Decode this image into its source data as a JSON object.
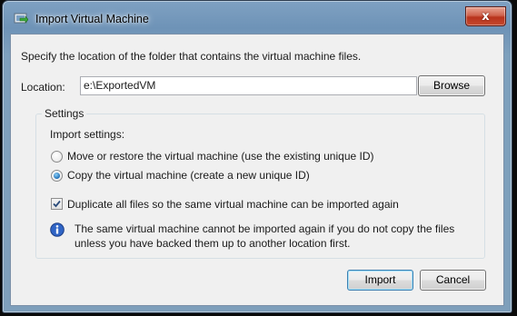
{
  "window": {
    "title": "Import Virtual Machine",
    "close_label": "x"
  },
  "dialog": {
    "instructions": "Specify the location of the folder that contains the virtual machine files.",
    "location_label": "Location:",
    "location_value": "e:\\ExportedVM",
    "browse_label": "Browse",
    "settings": {
      "legend": "Settings",
      "import_settings_label": "Import settings:",
      "options": [
        {
          "label": "Move or restore the virtual machine (use the existing unique ID)",
          "selected": false
        },
        {
          "label": "Copy the virtual machine (create a new unique ID)",
          "selected": true
        }
      ],
      "duplicate_label": "Duplicate all files so the same virtual machine can be imported again",
      "duplicate_checked": true,
      "info_text": "The same virtual machine cannot be imported again if you do not copy the files unless you have backed them up to another location first."
    },
    "import_label": "Import",
    "cancel_label": "Cancel"
  },
  "icons": {
    "title": "import-vm-icon",
    "info": "info-icon",
    "close": "close-icon"
  },
  "colors": {
    "title_bar": "#7a9dbf",
    "client_bg": "#f0f0f0",
    "close_button": "#c54a30",
    "radio_selected": "#1f6fb6",
    "info_icon": "#2f64c5"
  }
}
